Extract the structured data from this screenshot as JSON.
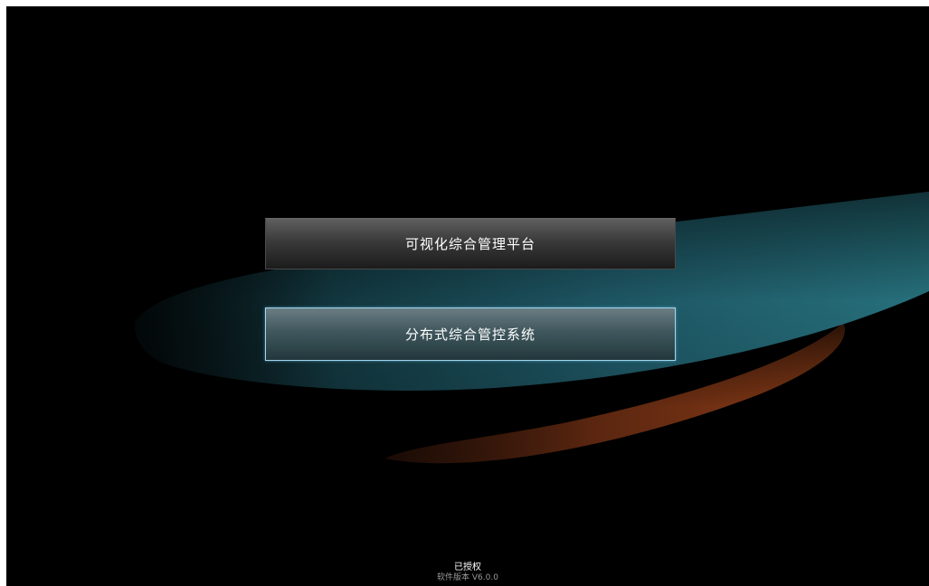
{
  "menu": {
    "items": [
      {
        "label": "可视化综合管理平台",
        "selected": false
      },
      {
        "label": "分布式综合管控系统",
        "selected": true
      }
    ]
  },
  "footer": {
    "auth_status": "已授权",
    "version": "软件版本 V6.0.0"
  },
  "colors": {
    "background": "#000000",
    "teal_wave": "#1f5e6a",
    "orange_wave": "#7a3415",
    "selected_border": "#9fd6ef"
  }
}
